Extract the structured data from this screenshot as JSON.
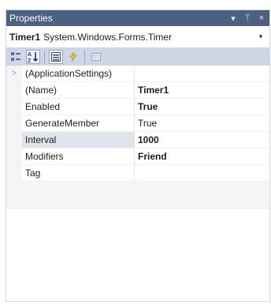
{
  "panel": {
    "title": "Properties",
    "controls": {
      "dropdown": "▾",
      "pin": "ᛘ",
      "close": "×"
    }
  },
  "object": {
    "name": "Timer1",
    "type": "System.Windows.Forms.Timer",
    "dropdown": "▾"
  },
  "toolbar": {
    "buttons": [
      "categorized-icon",
      "alphabetical-icon",
      "properties-icon",
      "events-icon",
      "property-pages-icon"
    ]
  },
  "properties": [
    {
      "name": "(ApplicationSettings)",
      "value": "",
      "expandable": true,
      "expander": ">"
    },
    {
      "name": "(Name)",
      "value": "Timer1",
      "bold": true
    },
    {
      "name": "Enabled",
      "value": "True",
      "bold": true
    },
    {
      "name": "GenerateMember",
      "value": "True",
      "bold": false
    },
    {
      "name": "Interval",
      "value": "1000",
      "bold": true,
      "selected": true
    },
    {
      "name": "Modifiers",
      "value": "Friend",
      "bold": true
    },
    {
      "name": "Tag",
      "value": "",
      "bold": false
    }
  ],
  "colors": {
    "title_bar": "#4d6082",
    "toolbar": "#cfd6e5",
    "selection": "#dfe3ea"
  }
}
